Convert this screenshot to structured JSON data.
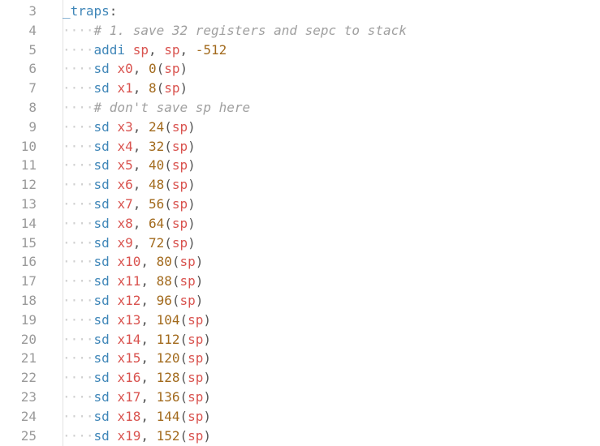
{
  "lines": [
    {
      "n": "3",
      "tokens": [
        {
          "t": "_traps",
          "c": "label"
        },
        {
          "t": ":",
          "c": "punct"
        }
      ],
      "indent": false
    },
    {
      "n": "4",
      "tokens": [
        {
          "t": "# 1. save 32 registers and sepc to stack",
          "c": "comment"
        }
      ],
      "indent": true
    },
    {
      "n": "5",
      "tokens": [
        {
          "t": "addi",
          "c": "op"
        },
        {
          "t": " ",
          "c": "punct"
        },
        {
          "t": "sp",
          "c": "reg"
        },
        {
          "t": ", ",
          "c": "punct"
        },
        {
          "t": "sp",
          "c": "reg"
        },
        {
          "t": ", ",
          "c": "punct"
        },
        {
          "t": "-512",
          "c": "num"
        }
      ],
      "indent": true
    },
    {
      "n": "6",
      "tokens": [
        {
          "t": "sd",
          "c": "op"
        },
        {
          "t": " ",
          "c": "punct"
        },
        {
          "t": "x0",
          "c": "reg"
        },
        {
          "t": ", ",
          "c": "punct"
        },
        {
          "t": "0",
          "c": "num"
        },
        {
          "t": "(",
          "c": "punct"
        },
        {
          "t": "sp",
          "c": "reg"
        },
        {
          "t": ")",
          "c": "punct"
        }
      ],
      "indent": true
    },
    {
      "n": "7",
      "tokens": [
        {
          "t": "sd",
          "c": "op"
        },
        {
          "t": " ",
          "c": "punct"
        },
        {
          "t": "x1",
          "c": "reg"
        },
        {
          "t": ", ",
          "c": "punct"
        },
        {
          "t": "8",
          "c": "num"
        },
        {
          "t": "(",
          "c": "punct"
        },
        {
          "t": "sp",
          "c": "reg"
        },
        {
          "t": ")",
          "c": "punct"
        }
      ],
      "indent": true
    },
    {
      "n": "8",
      "tokens": [
        {
          "t": "# don't save sp here",
          "c": "comment"
        }
      ],
      "indent": true
    },
    {
      "n": "9",
      "tokens": [
        {
          "t": "sd",
          "c": "op"
        },
        {
          "t": " ",
          "c": "punct"
        },
        {
          "t": "x3",
          "c": "reg"
        },
        {
          "t": ", ",
          "c": "punct"
        },
        {
          "t": "24",
          "c": "num"
        },
        {
          "t": "(",
          "c": "punct"
        },
        {
          "t": "sp",
          "c": "reg"
        },
        {
          "t": ")",
          "c": "punct"
        }
      ],
      "indent": true
    },
    {
      "n": "10",
      "tokens": [
        {
          "t": "sd",
          "c": "op"
        },
        {
          "t": " ",
          "c": "punct"
        },
        {
          "t": "x4",
          "c": "reg"
        },
        {
          "t": ", ",
          "c": "punct"
        },
        {
          "t": "32",
          "c": "num"
        },
        {
          "t": "(",
          "c": "punct"
        },
        {
          "t": "sp",
          "c": "reg"
        },
        {
          "t": ")",
          "c": "punct"
        }
      ],
      "indent": true
    },
    {
      "n": "11",
      "tokens": [
        {
          "t": "sd",
          "c": "op"
        },
        {
          "t": " ",
          "c": "punct"
        },
        {
          "t": "x5",
          "c": "reg"
        },
        {
          "t": ", ",
          "c": "punct"
        },
        {
          "t": "40",
          "c": "num"
        },
        {
          "t": "(",
          "c": "punct"
        },
        {
          "t": "sp",
          "c": "reg"
        },
        {
          "t": ")",
          "c": "punct"
        }
      ],
      "indent": true
    },
    {
      "n": "12",
      "tokens": [
        {
          "t": "sd",
          "c": "op"
        },
        {
          "t": " ",
          "c": "punct"
        },
        {
          "t": "x6",
          "c": "reg"
        },
        {
          "t": ", ",
          "c": "punct"
        },
        {
          "t": "48",
          "c": "num"
        },
        {
          "t": "(",
          "c": "punct"
        },
        {
          "t": "sp",
          "c": "reg"
        },
        {
          "t": ")",
          "c": "punct"
        }
      ],
      "indent": true
    },
    {
      "n": "13",
      "tokens": [
        {
          "t": "sd",
          "c": "op"
        },
        {
          "t": " ",
          "c": "punct"
        },
        {
          "t": "x7",
          "c": "reg"
        },
        {
          "t": ", ",
          "c": "punct"
        },
        {
          "t": "56",
          "c": "num"
        },
        {
          "t": "(",
          "c": "punct"
        },
        {
          "t": "sp",
          "c": "reg"
        },
        {
          "t": ")",
          "c": "punct"
        }
      ],
      "indent": true
    },
    {
      "n": "14",
      "tokens": [
        {
          "t": "sd",
          "c": "op"
        },
        {
          "t": " ",
          "c": "punct"
        },
        {
          "t": "x8",
          "c": "reg"
        },
        {
          "t": ", ",
          "c": "punct"
        },
        {
          "t": "64",
          "c": "num"
        },
        {
          "t": "(",
          "c": "punct"
        },
        {
          "t": "sp",
          "c": "reg"
        },
        {
          "t": ")",
          "c": "punct"
        }
      ],
      "indent": true
    },
    {
      "n": "15",
      "tokens": [
        {
          "t": "sd",
          "c": "op"
        },
        {
          "t": " ",
          "c": "punct"
        },
        {
          "t": "x9",
          "c": "reg"
        },
        {
          "t": ", ",
          "c": "punct"
        },
        {
          "t": "72",
          "c": "num"
        },
        {
          "t": "(",
          "c": "punct"
        },
        {
          "t": "sp",
          "c": "reg"
        },
        {
          "t": ")",
          "c": "punct"
        }
      ],
      "indent": true
    },
    {
      "n": "16",
      "tokens": [
        {
          "t": "sd",
          "c": "op"
        },
        {
          "t": " ",
          "c": "punct"
        },
        {
          "t": "x10",
          "c": "reg"
        },
        {
          "t": ", ",
          "c": "punct"
        },
        {
          "t": "80",
          "c": "num"
        },
        {
          "t": "(",
          "c": "punct"
        },
        {
          "t": "sp",
          "c": "reg"
        },
        {
          "t": ")",
          "c": "punct"
        }
      ],
      "indent": true
    },
    {
      "n": "17",
      "tokens": [
        {
          "t": "sd",
          "c": "op"
        },
        {
          "t": " ",
          "c": "punct"
        },
        {
          "t": "x11",
          "c": "reg"
        },
        {
          "t": ", ",
          "c": "punct"
        },
        {
          "t": "88",
          "c": "num"
        },
        {
          "t": "(",
          "c": "punct"
        },
        {
          "t": "sp",
          "c": "reg"
        },
        {
          "t": ")",
          "c": "punct"
        }
      ],
      "indent": true
    },
    {
      "n": "18",
      "tokens": [
        {
          "t": "sd",
          "c": "op"
        },
        {
          "t": " ",
          "c": "punct"
        },
        {
          "t": "x12",
          "c": "reg"
        },
        {
          "t": ", ",
          "c": "punct"
        },
        {
          "t": "96",
          "c": "num"
        },
        {
          "t": "(",
          "c": "punct"
        },
        {
          "t": "sp",
          "c": "reg"
        },
        {
          "t": ")",
          "c": "punct"
        }
      ],
      "indent": true
    },
    {
      "n": "19",
      "tokens": [
        {
          "t": "sd",
          "c": "op"
        },
        {
          "t": " ",
          "c": "punct"
        },
        {
          "t": "x13",
          "c": "reg"
        },
        {
          "t": ", ",
          "c": "punct"
        },
        {
          "t": "104",
          "c": "num"
        },
        {
          "t": "(",
          "c": "punct"
        },
        {
          "t": "sp",
          "c": "reg"
        },
        {
          "t": ")",
          "c": "punct"
        }
      ],
      "indent": true
    },
    {
      "n": "20",
      "tokens": [
        {
          "t": "sd",
          "c": "op"
        },
        {
          "t": " ",
          "c": "punct"
        },
        {
          "t": "x14",
          "c": "reg"
        },
        {
          "t": ", ",
          "c": "punct"
        },
        {
          "t": "112",
          "c": "num"
        },
        {
          "t": "(",
          "c": "punct"
        },
        {
          "t": "sp",
          "c": "reg"
        },
        {
          "t": ")",
          "c": "punct"
        }
      ],
      "indent": true
    },
    {
      "n": "21",
      "tokens": [
        {
          "t": "sd",
          "c": "op"
        },
        {
          "t": " ",
          "c": "punct"
        },
        {
          "t": "x15",
          "c": "reg"
        },
        {
          "t": ", ",
          "c": "punct"
        },
        {
          "t": "120",
          "c": "num"
        },
        {
          "t": "(",
          "c": "punct"
        },
        {
          "t": "sp",
          "c": "reg"
        },
        {
          "t": ")",
          "c": "punct"
        }
      ],
      "indent": true
    },
    {
      "n": "22",
      "tokens": [
        {
          "t": "sd",
          "c": "op"
        },
        {
          "t": " ",
          "c": "punct"
        },
        {
          "t": "x16",
          "c": "reg"
        },
        {
          "t": ", ",
          "c": "punct"
        },
        {
          "t": "128",
          "c": "num"
        },
        {
          "t": "(",
          "c": "punct"
        },
        {
          "t": "sp",
          "c": "reg"
        },
        {
          "t": ")",
          "c": "punct"
        }
      ],
      "indent": true
    },
    {
      "n": "23",
      "tokens": [
        {
          "t": "sd",
          "c": "op"
        },
        {
          "t": " ",
          "c": "punct"
        },
        {
          "t": "x17",
          "c": "reg"
        },
        {
          "t": ", ",
          "c": "punct"
        },
        {
          "t": "136",
          "c": "num"
        },
        {
          "t": "(",
          "c": "punct"
        },
        {
          "t": "sp",
          "c": "reg"
        },
        {
          "t": ")",
          "c": "punct"
        }
      ],
      "indent": true
    },
    {
      "n": "24",
      "tokens": [
        {
          "t": "sd",
          "c": "op"
        },
        {
          "t": " ",
          "c": "punct"
        },
        {
          "t": "x18",
          "c": "reg"
        },
        {
          "t": ", ",
          "c": "punct"
        },
        {
          "t": "144",
          "c": "num"
        },
        {
          "t": "(",
          "c": "punct"
        },
        {
          "t": "sp",
          "c": "reg"
        },
        {
          "t": ")",
          "c": "punct"
        }
      ],
      "indent": true
    },
    {
      "n": "25",
      "tokens": [
        {
          "t": "sd",
          "c": "op"
        },
        {
          "t": " ",
          "c": "punct"
        },
        {
          "t": "x19",
          "c": "reg"
        },
        {
          "t": ", ",
          "c": "punct"
        },
        {
          "t": "152",
          "c": "num"
        },
        {
          "t": "(",
          "c": "punct"
        },
        {
          "t": "sp",
          "c": "reg"
        },
        {
          "t": ")",
          "c": "punct"
        }
      ],
      "indent": true
    }
  ],
  "indent_marker": "····"
}
